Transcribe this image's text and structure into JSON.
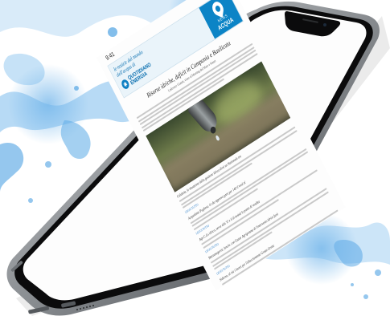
{
  "status": {
    "time": "9:41"
  },
  "banner": {
    "tagline_1": "le notizie dal mondo",
    "tagline_2": "dell'acqua di",
    "brand_top": "QUOTIDIANO",
    "brand_bottom": "ENERGIA",
    "news_label": "NEWS",
    "acqua_label": "ACQUA"
  },
  "article": {
    "headline": "Risorse idriche, deficit in Campania e Basilicata",
    "subline": "Lodovico Gianni, vinto al Meeting del Mare e Smart",
    "sections": [
      {
        "title": "Calabria, le situazione della gestione idrica dirsi un Nazionale tra"
      },
      {
        "title": "Acquedotto Pugliese, il cda approva gara per 140 il vuol al"
      },
      {
        "title": "Agn C.d.s idrico, serve alla 'il' e il di assisti le punto di vendita"
      },
      {
        "title": "Mezzanagarisi, lancio, con Gutter Agrigemma di l'intervento idrico farà"
      },
      {
        "title": "Siderno, al via i lavori per l'allacciamento Grotte Grotte"
      }
    ],
    "readmore_label": "LEGGI TUTTO",
    "footer_label": "Regione, il servizio idrico a Bari"
  },
  "colors": {
    "accent_blue": "#0c84c6",
    "banner_bg": "#eaf4fa",
    "link_blue": "#1a73c4"
  }
}
